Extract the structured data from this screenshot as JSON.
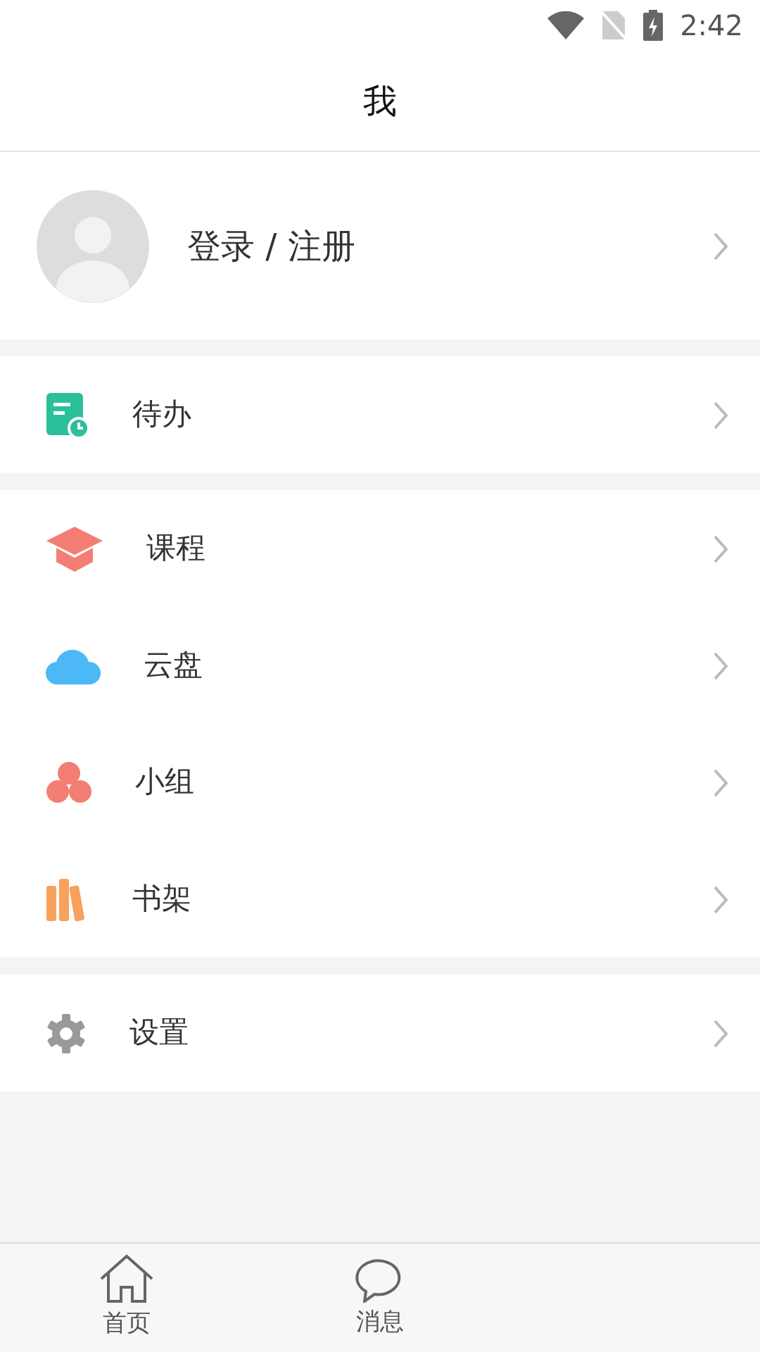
{
  "status_bar": {
    "time": "2:42"
  },
  "header": {
    "title": "我"
  },
  "profile": {
    "label": "登录 / 注册"
  },
  "menu_sections": [
    {
      "items": [
        {
          "kind": "todo",
          "label": "待办"
        }
      ]
    },
    {
      "items": [
        {
          "kind": "course",
          "label": "课程"
        },
        {
          "kind": "cloud",
          "label": "云盘"
        },
        {
          "kind": "group",
          "label": "小组"
        },
        {
          "kind": "bookshelf",
          "label": "书架"
        }
      ]
    },
    {
      "items": [
        {
          "kind": "settings",
          "label": "设置"
        }
      ]
    }
  ],
  "tab_bar": [
    {
      "kind": "home",
      "label": "首页",
      "selected": false
    },
    {
      "kind": "message",
      "label": "消息",
      "selected": false
    }
  ]
}
